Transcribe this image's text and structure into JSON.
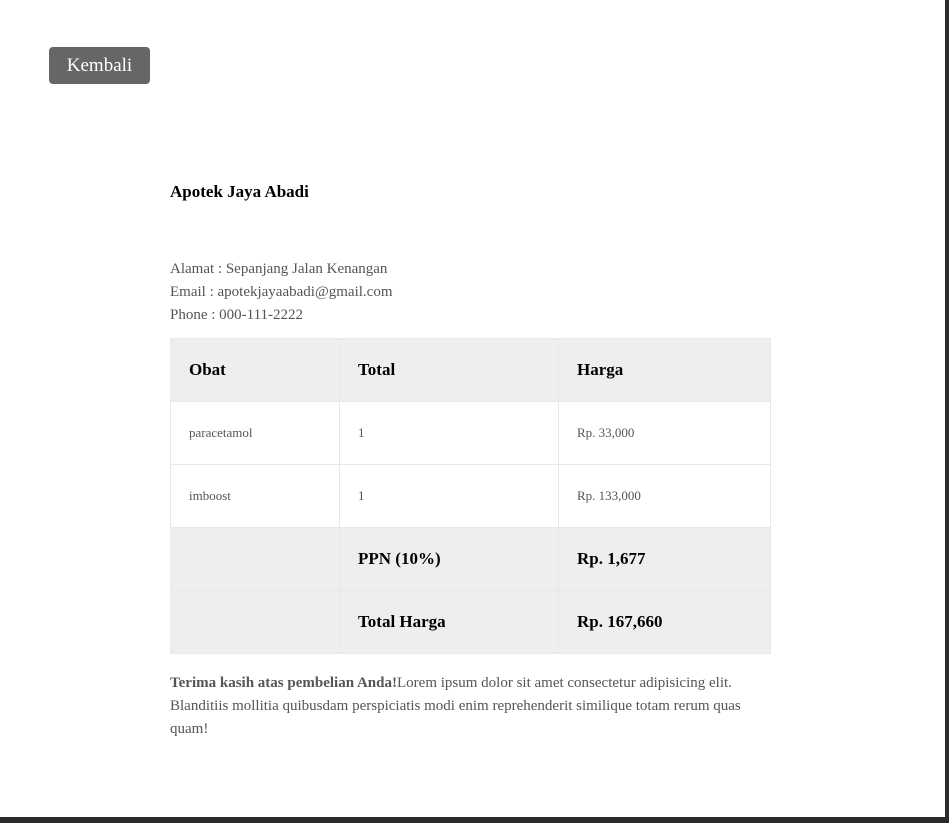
{
  "back_button": {
    "label": "Kembali"
  },
  "store": {
    "name": "Apotek Jaya Abadi",
    "address": "Alamat : Sepanjang Jalan Kenangan",
    "email": "Email : apotekjayaabadi@gmail.com",
    "phone": "Phone : 000-111-2222"
  },
  "table": {
    "headers": [
      "Obat",
      "Total",
      "Harga"
    ],
    "rows": [
      {
        "obat": "paracetamol",
        "total": "1",
        "harga": "Rp. 33,000"
      },
      {
        "obat": "imboost",
        "total": "1",
        "harga": "Rp. 133,000"
      }
    ],
    "ppn": {
      "label": "PPN (10%)",
      "value": "Rp. 1,677"
    },
    "grand_total": {
      "label": "Total Harga",
      "value": "Rp. 167,660"
    }
  },
  "footer": {
    "thanks_bold": "Terima kasih atas pembelian Anda!",
    "thanks_text": "Lorem ipsum dolor sit amet consectetur adipisicing elit. Blanditiis mollitia quibusdam perspiciatis modi enim reprehenderit similique totam rerum quas quam!"
  }
}
